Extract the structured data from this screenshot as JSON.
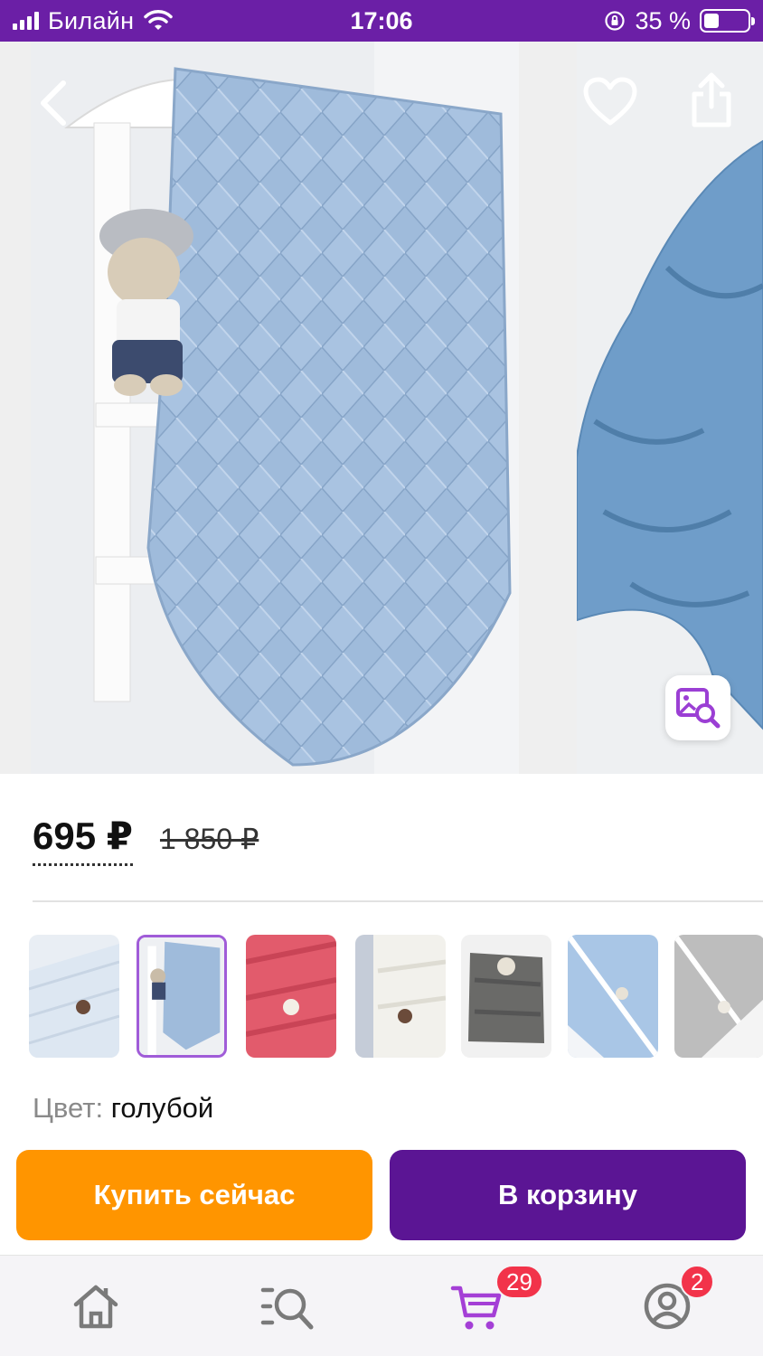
{
  "status_bar": {
    "carrier": "Билайн",
    "time": "17:06",
    "battery_percent": "35 %",
    "battery_level": 0.35
  },
  "product": {
    "price_current": "695 ₽",
    "price_old": "1 850 ₽",
    "color_label": "Цвет:",
    "color_value": "голубой",
    "selected_thumbnail_index": 1,
    "thumbnail_count": 7
  },
  "actions": {
    "buy_now_label": "Купить сейчас",
    "add_to_cart_label": "В корзину"
  },
  "tabbar": {
    "items": [
      {
        "name": "home",
        "icon": "home-icon"
      },
      {
        "name": "catalog",
        "icon": "search-catalog-icon"
      },
      {
        "name": "cart",
        "icon": "cart-icon",
        "badge": "29",
        "active": true
      },
      {
        "name": "profile",
        "icon": "profile-icon",
        "badge": "2"
      }
    ]
  },
  "colors": {
    "brand_purple": "#5b1594",
    "status_bar": "#6b1fa6",
    "buy_orange": "#ff9500",
    "badge_red": "#f2334a",
    "active_tab": "#a43fd6"
  }
}
